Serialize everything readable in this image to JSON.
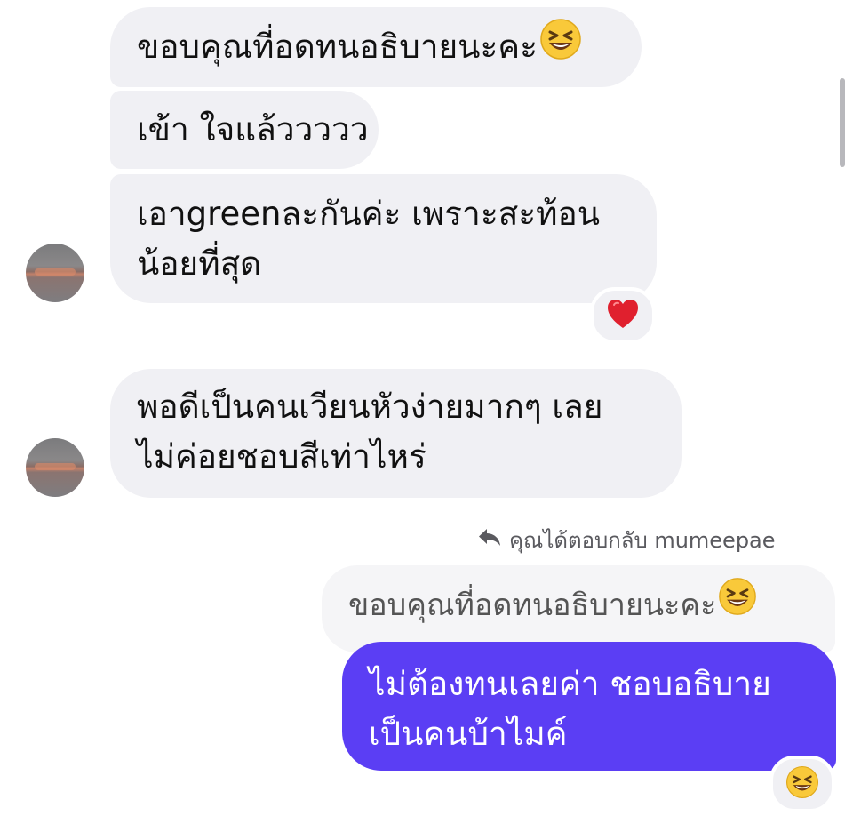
{
  "messages": {
    "m1": {
      "text": "ขอบคุณที่อดทนอธิบายนะคะ",
      "emoji": "laughing-emoji"
    },
    "m2": {
      "text": "เข้า ใจแล้ววววว"
    },
    "m3": {
      "line1": "เอาgreenละกันค่ะ เพราะสะท้อน",
      "line2": "น้อยที่สุด",
      "reaction": "heart-emoji"
    },
    "m4": {
      "line1": "พอดีเป็นคนเวียนหัวง่ายมากๆ เลย",
      "line2": "ไม่ค่อยชอบสีเท่าไหร่"
    }
  },
  "reply": {
    "label": "คุณได้ตอบกลับ mumeepae",
    "quoted_text": "ขอบคุณที่อดทนอธิบายนะคะ",
    "quoted_emoji": "laughing-emoji"
  },
  "my_message": {
    "line1": "ไม่ต้องทนเลยค่า ชอบอธิบาย",
    "line2": "เป็นคนบ้าไมค์",
    "reaction": "laughing-emoji"
  },
  "colors": {
    "incoming_bubble": "#f0f0f4",
    "outgoing_bubble": "#5b3ef4",
    "reply_label": "#5a5a5f"
  }
}
